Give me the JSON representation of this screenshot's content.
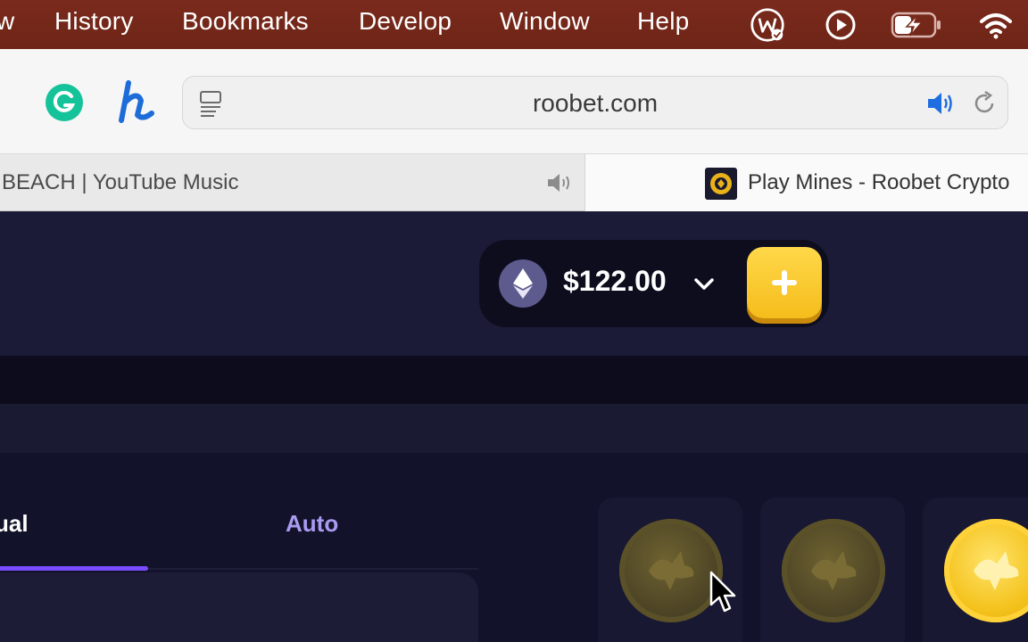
{
  "menubar": {
    "items": [
      "w",
      "History",
      "Bookmarks",
      "Develop",
      "Window",
      "Help"
    ],
    "tray_icons": [
      "web-clip-icon",
      "play-circle-icon",
      "battery-charging-icon",
      "wifi-icon"
    ]
  },
  "toolbar": {
    "extensions": [
      "grammarly-icon",
      "honey-icon"
    ],
    "address": "roobet.com",
    "reader_icon": "reader-view-icon",
    "audio_icon": "speaker-icon",
    "reload_icon": "reload-icon"
  },
  "tabs": [
    {
      "title": "BEACH | YouTube Music",
      "icon": "speaker-muted-icon",
      "active": false
    },
    {
      "title": "Play Mines - Roobet Crypto",
      "icon": "roobet-favicon",
      "active": true
    }
  ],
  "wallet": {
    "currency_icon": "ethereum-icon",
    "balance": "$122.00",
    "dropdown_icon": "chevron-down-icon",
    "deposit_icon": "plus-icon"
  },
  "game": {
    "mode_tabs": [
      {
        "label": "ual",
        "active": true
      },
      {
        "label": "Auto",
        "active": false
      }
    ],
    "tiles": [
      {
        "state": "hidden",
        "icon": "roo-coin-icon"
      },
      {
        "state": "hidden",
        "icon": "roo-coin-icon"
      },
      {
        "state": "revealed",
        "icon": "roo-coin-icon"
      }
    ]
  },
  "colors": {
    "menubar": "#7a2a1c",
    "site_bg": "#1b1b38",
    "accent_purple": "#7a4cff",
    "deposit_yellow": "#f5bd1b",
    "auto_tab_text": "#a89bf0"
  }
}
